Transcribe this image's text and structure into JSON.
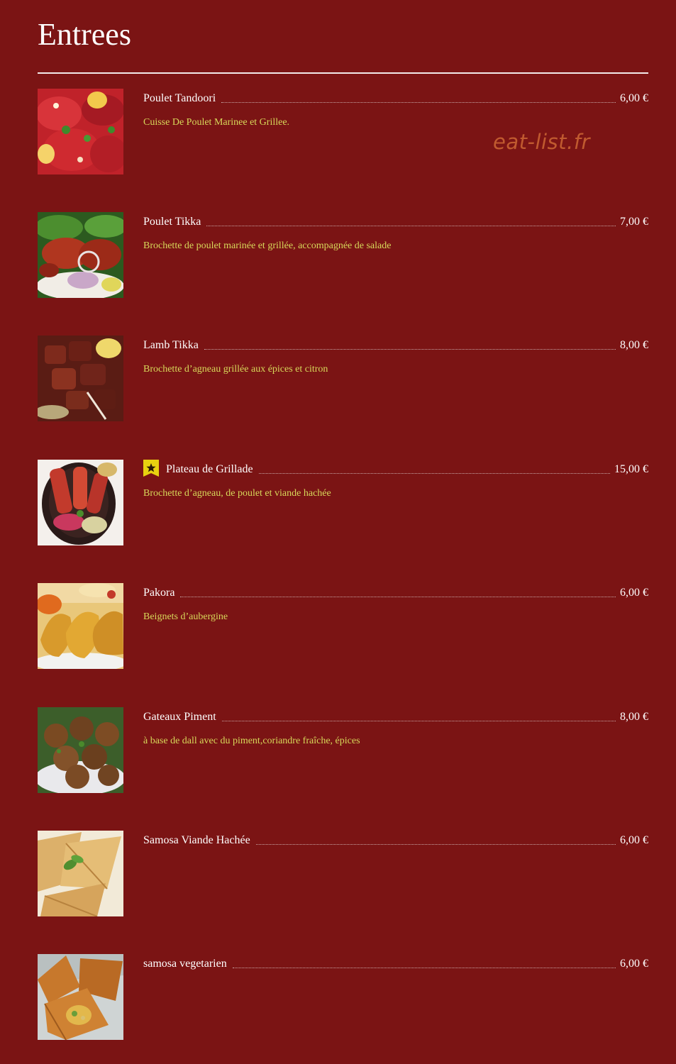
{
  "page": {
    "title": "Entrees",
    "watermark": "eat-list.fr"
  },
  "colors": {
    "background": "#7b1414",
    "title_text": "#ffffff",
    "description_text": "#d7d85a",
    "watermark_text": "#c05a2f",
    "badge_yellow": "#e8d210"
  },
  "menu": {
    "items": [
      {
        "name": "Poulet Tandoori",
        "price": "6,00 €",
        "description": "Cuisse De Poulet Marinee et Grillee.",
        "image": "tandoori-chicken-photo",
        "featured": false
      },
      {
        "name": "Poulet Tikka",
        "price": "7,00 €",
        "description": "Brochette de poulet marinée et grillée, accompagnée de salade",
        "image": "chicken-tikka-photo",
        "featured": false
      },
      {
        "name": "Lamb Tikka",
        "price": "8,00 €",
        "description": "Brochette d’agneau grillée aux épices et citron",
        "image": "lamb-tikka-photo",
        "featured": false
      },
      {
        "name": "Plateau de Grillade",
        "price": "15,00 €",
        "description": "Brochette d’agneau, de poulet et viande hachée",
        "image": "grill-platter-photo",
        "featured": true,
        "badge_icon": "star-badge-icon"
      },
      {
        "name": "Pakora",
        "price": "6,00 €",
        "description": "Beignets d’aubergine",
        "image": "pakora-photo",
        "featured": false
      },
      {
        "name": "Gateaux Piment",
        "price": "8,00 €",
        "description": "à base de dall avec du piment,coriandre fraîche, épices",
        "image": "chili-cakes-photo",
        "featured": false
      },
      {
        "name": "Samosa Viande Hachée",
        "price": "6,00 €",
        "description": "",
        "image": "meat-samosa-photo",
        "featured": false
      },
      {
        "name": "samosa vegetarien",
        "price": "6,00 €",
        "description": "",
        "image": "veg-samosa-photo",
        "featured": false
      }
    ]
  }
}
